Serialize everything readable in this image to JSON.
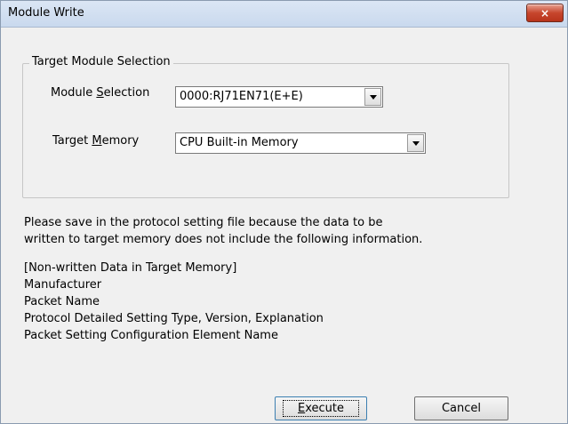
{
  "window": {
    "title": "Module Write",
    "close_label": "×"
  },
  "group": {
    "legend": "Target Module Selection"
  },
  "module_selection": {
    "label_pre": "Module ",
    "label_mnemonic": "S",
    "label_post": "election",
    "value": "0000:RJ71EN71(E+E)"
  },
  "target_memory": {
    "label_pre": "Target ",
    "label_mnemonic": "M",
    "label_post": "emory",
    "value": "CPU Built-in Memory"
  },
  "message": {
    "line1": "Please save in the protocol setting file because the data to be",
    "line2": "written to target memory does not include the following information.",
    "items": [
      "[Non-written Data in Target Memory]",
      "Manufacturer",
      "Packet Name",
      "Protocol Detailed Setting Type, Version, Explanation",
      "Packet Setting Configuration Element Name"
    ]
  },
  "buttons": {
    "execute_mnemonic": "E",
    "execute_rest": "xecute",
    "cancel": "Cancel"
  }
}
